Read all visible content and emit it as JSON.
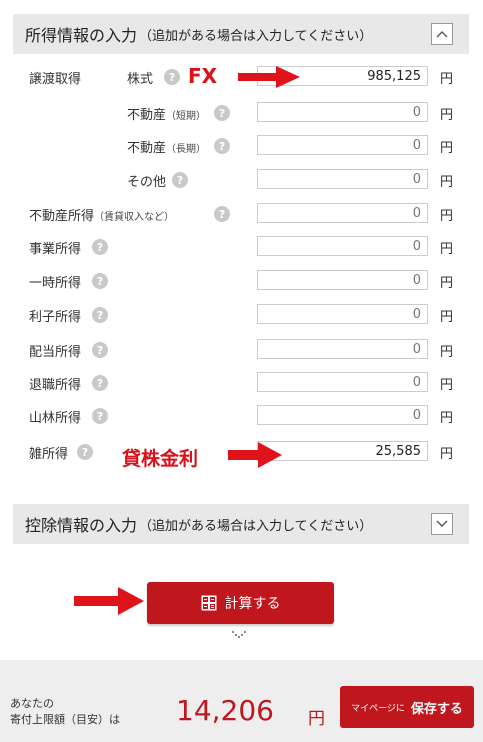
{
  "income_section": {
    "title": "所得情報の入力",
    "subtitle": "（追加がある場合は入力してください）",
    "toggle_icon": "chevron-up-icon"
  },
  "transfer_group_label": "譲渡取得",
  "rows": [
    {
      "label": "株式",
      "value": "985,125",
      "placeholder": "0",
      "unit": "円"
    },
    {
      "label": "不動産",
      "note": "（短期）",
      "value": "",
      "placeholder": "0",
      "unit": "円"
    },
    {
      "label": "不動産",
      "note": "（長期）",
      "value": "",
      "placeholder": "0",
      "unit": "円"
    },
    {
      "label": "その他",
      "value": "",
      "placeholder": "0",
      "unit": "円"
    },
    {
      "label": "不動産所得",
      "note": "（賃貸収入など）",
      "value": "",
      "placeholder": "0",
      "unit": "円"
    },
    {
      "label": "事業所得",
      "value": "",
      "placeholder": "0",
      "unit": "円"
    },
    {
      "label": "一時所得",
      "value": "",
      "placeholder": "0",
      "unit": "円"
    },
    {
      "label": "利子所得",
      "value": "",
      "placeholder": "0",
      "unit": "円"
    },
    {
      "label": "配当所得",
      "value": "",
      "placeholder": "0",
      "unit": "円"
    },
    {
      "label": "退職所得",
      "value": "",
      "placeholder": "0",
      "unit": "円"
    },
    {
      "label": "山林所得",
      "value": "",
      "placeholder": "0",
      "unit": "円"
    },
    {
      "label": "雑所得",
      "value": "25,585",
      "placeholder": "0",
      "unit": "円"
    }
  ],
  "help_icon_glyph": "?",
  "annotations": {
    "fx": "FX",
    "lending": "貸株金利",
    "color": "#d9111b"
  },
  "deduction_section": {
    "title": "控除情報の入力",
    "subtitle": "（追加がある場合は入力してください）",
    "toggle_icon": "chevron-down-icon"
  },
  "calc_button": {
    "label": "計算する",
    "icon": "calculator-icon"
  },
  "footer": {
    "caption_line1": "あなたの",
    "caption_line2": "寄付上限額（目安）は",
    "amount": "14,206",
    "unit": "円",
    "save_prefix": "マイページに",
    "save_label": "保存する"
  },
  "colors": {
    "accent": "#c0171e",
    "header_bg": "#e8e8e8",
    "footer_bg": "#eeeeee"
  }
}
